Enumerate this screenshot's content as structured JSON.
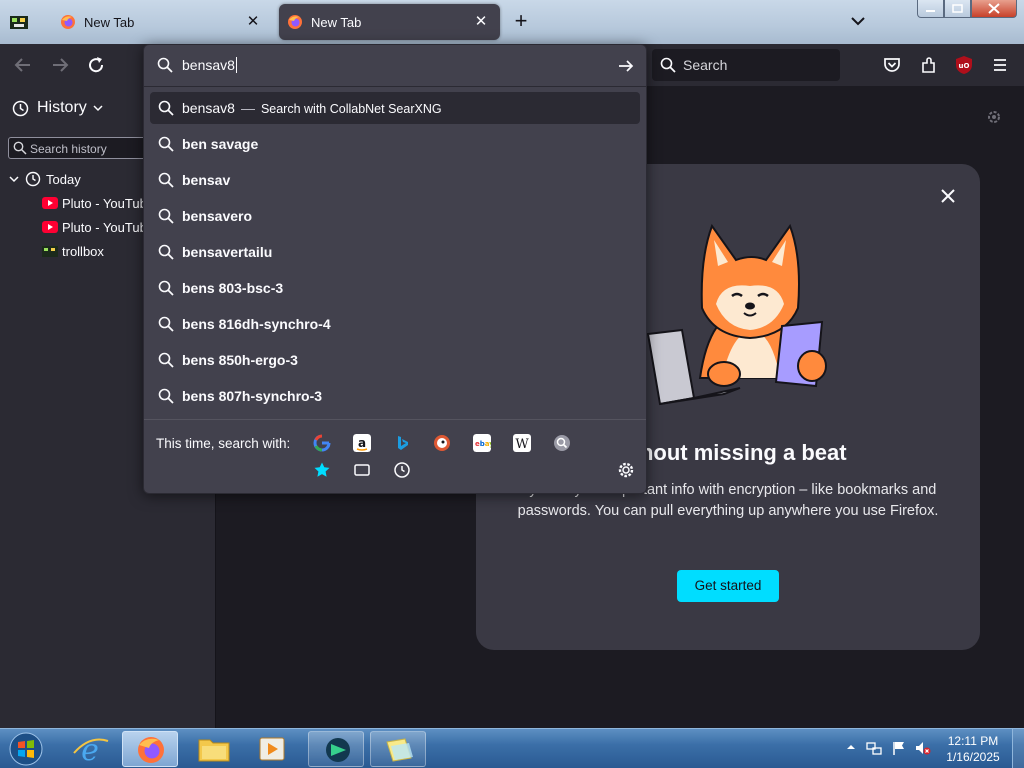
{
  "tabs": [
    {
      "title": "New Tab"
    },
    {
      "title": "New Tab"
    }
  ],
  "toolbar": {
    "search_placeholder": "Search"
  },
  "sidebar": {
    "title": "History",
    "search_placeholder": "Search history",
    "group": "Today",
    "items": [
      {
        "label": "Pluto - YouTube",
        "icon": "youtube-icon"
      },
      {
        "label": "Pluto - YouTube",
        "icon": "youtube-icon"
      },
      {
        "label": "trollbox",
        "icon": "trollbox-favicon"
      }
    ]
  },
  "urlbar": {
    "value": "bensav8",
    "active_suggestion": {
      "query": "bensav8",
      "dash": "—",
      "action": "Search with CollabNet SearXNG"
    },
    "suggestions": [
      "ben savage",
      "bensav",
      "bensavero",
      "bensavertailu",
      "bens 803-bsc-3",
      "bens 816dh-synchro-4",
      "bens 850h-ergo-3",
      "bens 807h-synchro-3"
    ],
    "one_off_label": "This time, search with:",
    "engines": [
      "google-icon",
      "amazon-icon",
      "bing-icon",
      "duckduckgo-icon",
      "ebay-icon",
      "wikipedia-icon",
      "searxng-icon",
      "bookmarks-icon",
      "tabs-icon",
      "history-icon"
    ]
  },
  "promo": {
    "title": "without missing a beat",
    "body": "Sync all your important info with encryption – like bookmarks and passwords. You can pull everything up anywhere you use Firefox.",
    "cta": "Get started"
  },
  "taskbar": {
    "apps": [
      "internet-explorer-icon",
      "firefox-icon",
      "file-explorer-icon",
      "media-player-icon",
      "app-icon",
      "sticky-notes-icon"
    ],
    "time": "12:11 PM",
    "date": "1/16/2025"
  },
  "colors": {
    "accent": "#00ddff",
    "toolbar": "#2b2a33",
    "panel": "#42414d",
    "page": "#1c1b22"
  }
}
